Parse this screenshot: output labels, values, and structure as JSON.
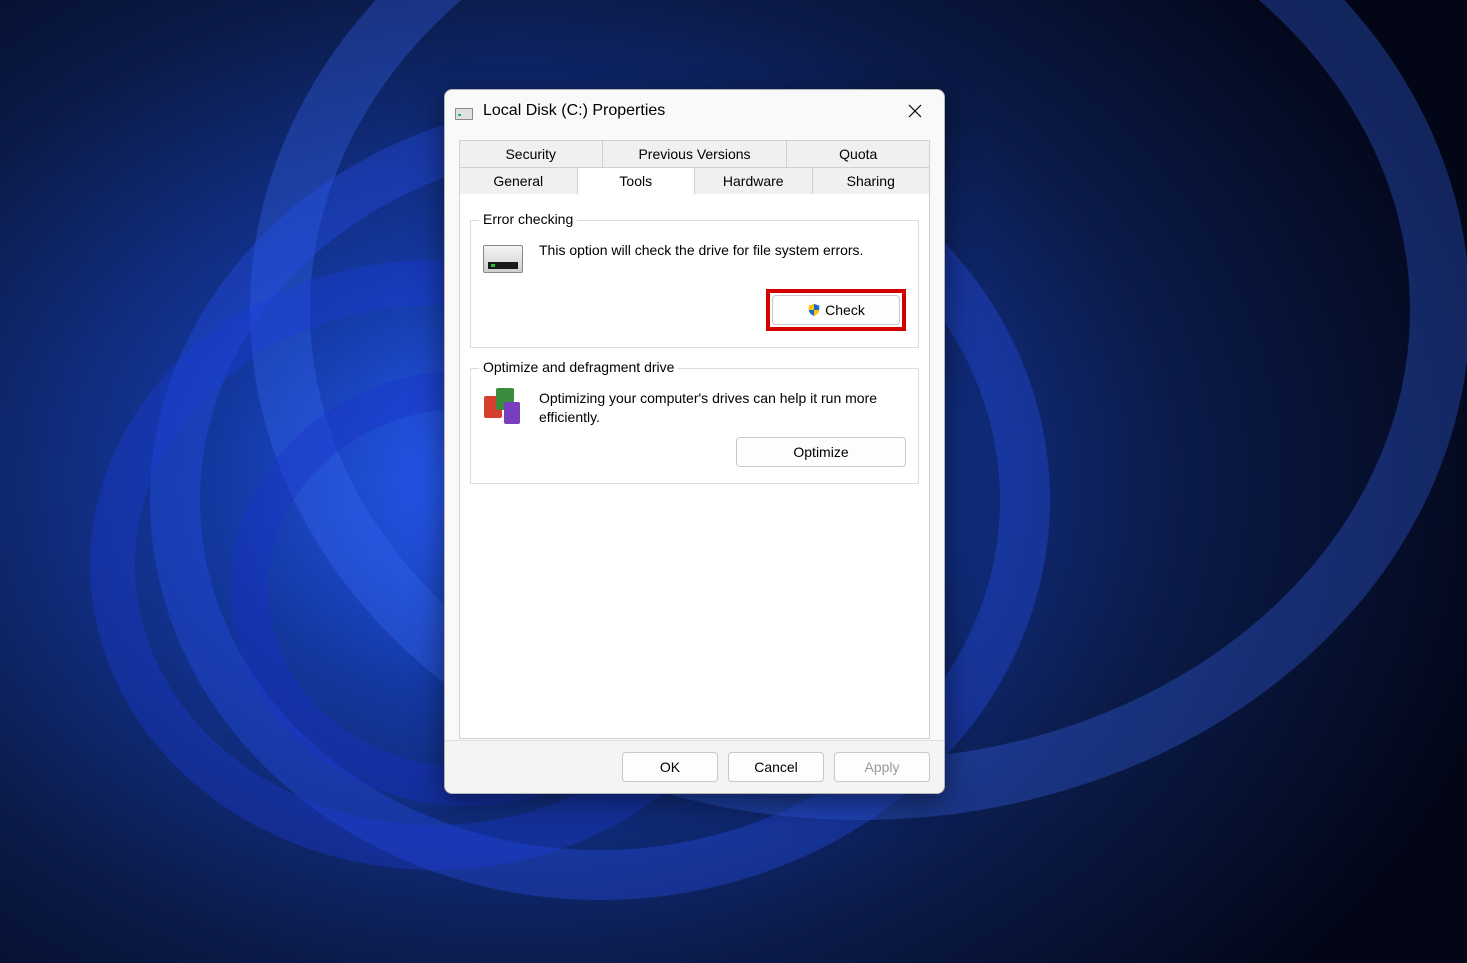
{
  "window": {
    "title": "Local Disk (C:) Properties"
  },
  "tabs": {
    "row1": [
      "Security",
      "Previous Versions",
      "Quota"
    ],
    "row2": [
      "General",
      "Tools",
      "Hardware",
      "Sharing"
    ],
    "active": "Tools"
  },
  "error_checking": {
    "legend": "Error checking",
    "description": "This option will check the drive for file system errors.",
    "button": "Check"
  },
  "optimize": {
    "legend": "Optimize and defragment drive",
    "description": "Optimizing your computer's drives can help it run more efficiently.",
    "button": "Optimize"
  },
  "footer": {
    "ok": "OK",
    "cancel": "Cancel",
    "apply": "Apply"
  }
}
